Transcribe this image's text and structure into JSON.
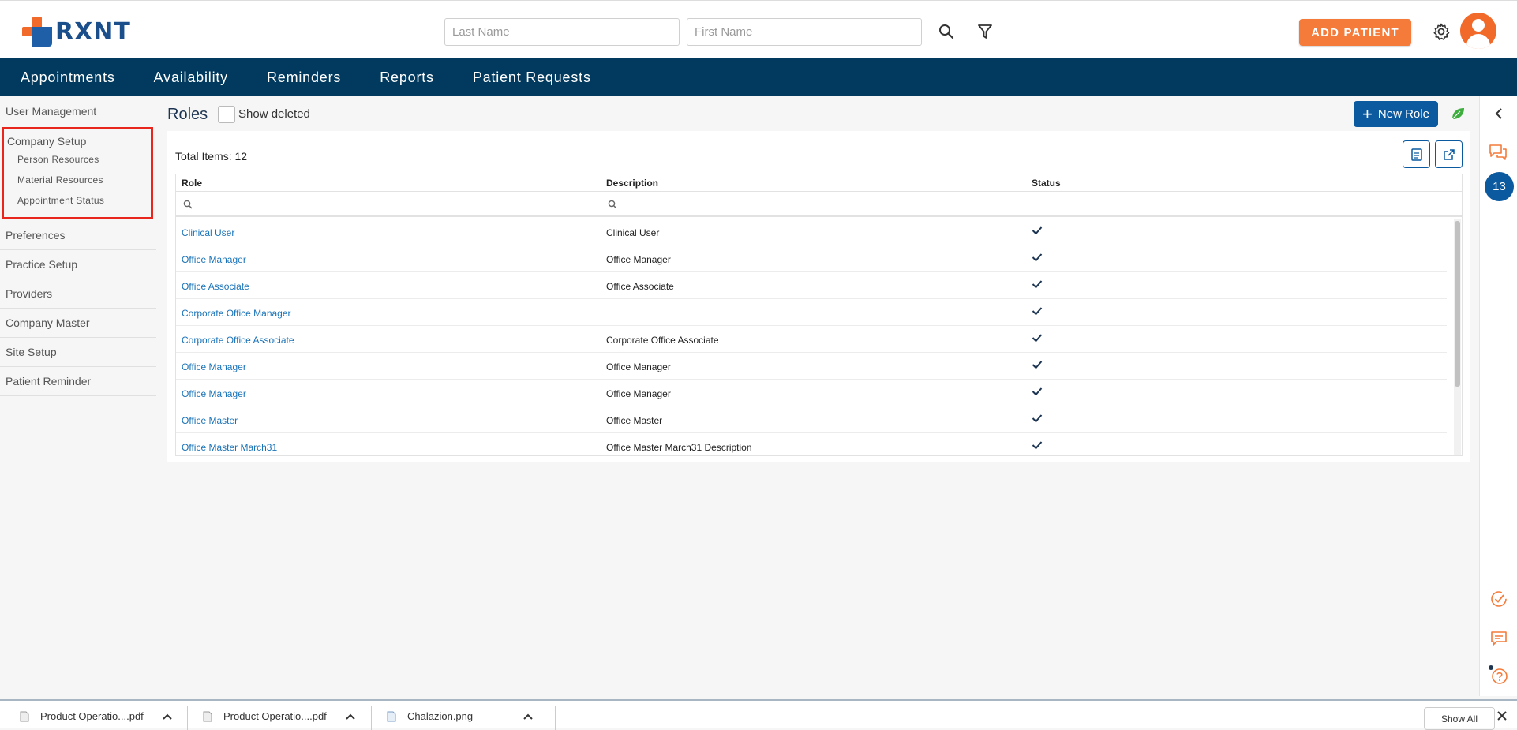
{
  "brand": {
    "logo_text": "RXNT"
  },
  "header": {
    "last_name_placeholder": "Last Name",
    "first_name_placeholder": "First Name",
    "add_patient_label": "ADD PATIENT"
  },
  "nav": {
    "items": [
      "Appointments",
      "Availability",
      "Reminders",
      "Reports",
      "Patient Requests"
    ]
  },
  "sidebar": {
    "user_management": "User Management",
    "company_setup": {
      "title": "Company Setup",
      "children": [
        "Person Resources",
        "Material Resources",
        "Appointment Status"
      ]
    },
    "items": [
      "Preferences",
      "Practice Setup",
      "Providers",
      "Company Master",
      "Site Setup",
      "Patient Reminder"
    ]
  },
  "main": {
    "title": "Roles",
    "show_deleted_label": "Show deleted",
    "new_role_label": "New Role",
    "total_items": "Total Items: 12"
  },
  "table": {
    "columns": [
      "Role",
      "Description",
      "Status"
    ],
    "rows": [
      {
        "role": "Clinical User",
        "description": "Clinical User",
        "status": "active"
      },
      {
        "role": "Office Manager",
        "description": "Office Manager",
        "status": "active"
      },
      {
        "role": "Office Associate",
        "description": "Office Associate",
        "status": "active"
      },
      {
        "role": "Corporate Office Manager",
        "description": "",
        "status": "active"
      },
      {
        "role": "Corporate Office Associate",
        "description": "Corporate Office Associate",
        "status": "active"
      },
      {
        "role": "Office Manager",
        "description": "Office Manager",
        "status": "active"
      },
      {
        "role": "Office Manager",
        "description": "Office Manager",
        "status": "active"
      },
      {
        "role": "Office Master",
        "description": "Office Master",
        "status": "active"
      },
      {
        "role": "Office Master March31",
        "description": "Office Master March31 Description",
        "status": "active"
      }
    ]
  },
  "rightbar": {
    "badge": "13"
  },
  "downloads": {
    "items": [
      "Product Operatio....pdf",
      "Product Operatio....pdf",
      "Chalazion.png"
    ],
    "show_all_label": "Show All"
  },
  "colors": {
    "nav_bg": "#013a5e",
    "accent_orange": "#f47b3a",
    "primary_blue": "#0b5aa0",
    "highlight_red": "#e8261d",
    "link_blue": "#1a73b8"
  }
}
